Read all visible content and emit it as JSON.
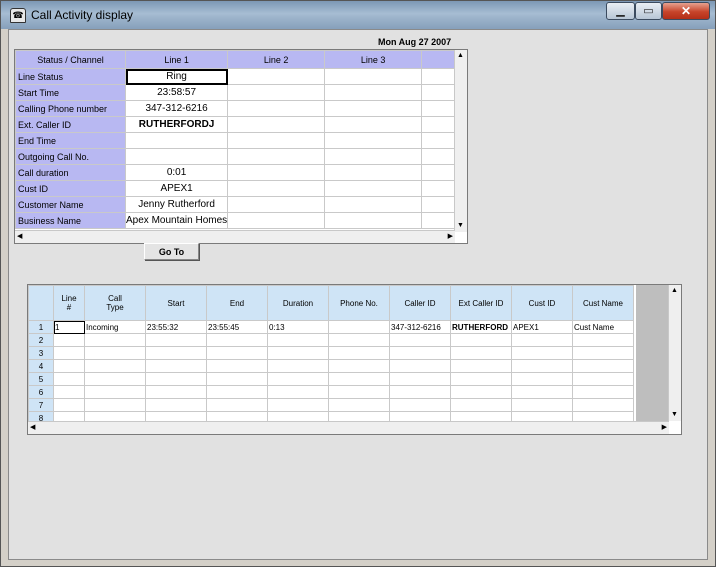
{
  "window": {
    "title": "Call Activity display",
    "app_icon": "phone-icon"
  },
  "date": "Mon Aug 27 2007",
  "status_grid": {
    "header": [
      "Status / Channel",
      "Line 1",
      "Line 2",
      "Line 3",
      ""
    ],
    "rows": [
      {
        "label": "Line Status",
        "line1": "Ring",
        "bold": false
      },
      {
        "label": "Start Time",
        "line1": "23:58:57",
        "bold": false
      },
      {
        "label": "Calling Phone number",
        "line1": "347-312-6216",
        "bold": false
      },
      {
        "label": "Ext. Caller ID",
        "line1": "RUTHERFORDJ",
        "bold": true
      },
      {
        "label": "End Time",
        "line1": "",
        "bold": false
      },
      {
        "label": "Outgoing Call No.",
        "line1": "",
        "bold": false
      },
      {
        "label": "Call duration",
        "line1": "0:01",
        "bold": false
      },
      {
        "label": "Cust ID",
        "line1": "APEX1",
        "bold": false
      },
      {
        "label": "Customer Name",
        "line1": "Jenny Rutherford",
        "bold": false
      },
      {
        "label": "Business Name",
        "line1": "Apex Mountain Homes",
        "bold": false
      }
    ]
  },
  "goto_button": "Go To",
  "call_log": {
    "columns": [
      "",
      "Line\n#",
      "Call\nType",
      "Start",
      "End",
      "Duration",
      "Phone No.",
      "Caller ID",
      "Ext Caller ID",
      "Cust ID",
      "Cust Name"
    ],
    "rows": [
      [
        "1",
        "1",
        "Incoming",
        "23:55:32",
        "23:55:45",
        "0:13",
        "",
        "347-312-6216",
        "RUTHERFORD",
        "APEX1",
        "Cust Name"
      ],
      [
        "2",
        "",
        "",
        "",
        "",
        "",
        "",
        "",
        "",
        "",
        ""
      ],
      [
        "3",
        "",
        "",
        "",
        "",
        "",
        "",
        "",
        "",
        "",
        ""
      ],
      [
        "4",
        "",
        "",
        "",
        "",
        "",
        "",
        "",
        "",
        "",
        ""
      ],
      [
        "5",
        "",
        "",
        "",
        "",
        "",
        "",
        "",
        "",
        "",
        ""
      ],
      [
        "6",
        "",
        "",
        "",
        "",
        "",
        "",
        "",
        "",
        "",
        ""
      ],
      [
        "7",
        "",
        "",
        "",
        "",
        "",
        "",
        "",
        "",
        "",
        ""
      ],
      [
        "8",
        "",
        "",
        "",
        "",
        "",
        "",
        "",
        "",
        "",
        ""
      ]
    ]
  }
}
